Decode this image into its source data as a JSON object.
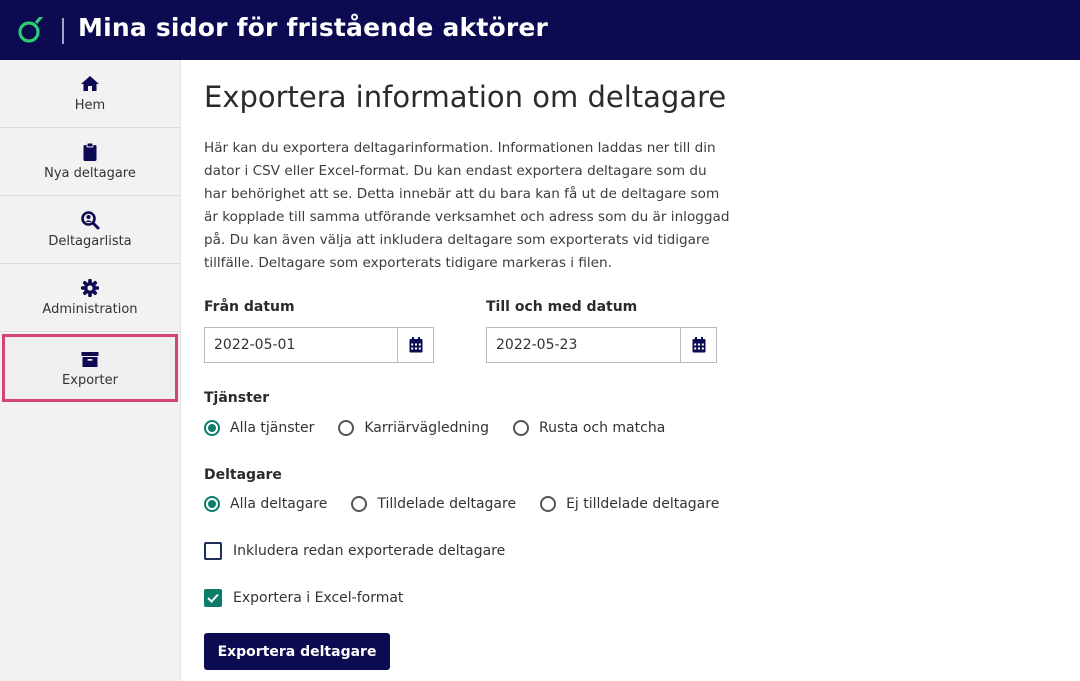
{
  "app": {
    "title": "Mina sidor för fristående aktörer",
    "brand_color": "#0c0b52",
    "accent_green": "#0a7c67",
    "active_border_color": "#d6427a"
  },
  "sidebar": {
    "items": [
      {
        "label": "Hem",
        "icon": "home-icon",
        "active": false
      },
      {
        "label": "Nya deltagare",
        "icon": "clipboard-icon",
        "active": false
      },
      {
        "label": "Deltagarlista",
        "icon": "search-user-icon",
        "active": false
      },
      {
        "label": "Administration",
        "icon": "gear-icon",
        "active": false
      },
      {
        "label": "Exporter",
        "icon": "archive-box-icon",
        "active": true
      }
    ]
  },
  "main": {
    "title": "Exportera information om deltagare",
    "intro": "Här kan du exportera deltagarinformation. Informationen laddas ner till din dator i CSV eller Excel-format. Du kan endast exportera deltagare som du har behörighet att se. Detta innebär att du bara kan få ut de deltagare som är kopplade till samma utförande verksamhet och adress som du är inloggad på. Du kan även välja att inkludera deltagare som exporterats vid tidigare tillfälle. Deltagare som exporterats tidigare markeras i filen.",
    "from_date": {
      "label": "Från datum",
      "value": "2022-05-01"
    },
    "to_date": {
      "label": "Till och med datum",
      "value": "2022-05-23"
    },
    "services": {
      "label": "Tjänster",
      "options": [
        "Alla tjänster",
        "Karriärvägledning",
        "Rusta och matcha"
      ],
      "selected": "Alla tjänster"
    },
    "participants": {
      "label": "Deltagare",
      "options": [
        "Alla deltagare",
        "Tilldelade deltagare",
        "Ej tilldelade deltagare"
      ],
      "selected": "Alla deltagare"
    },
    "include_exported": {
      "label": "Inkludera redan exporterade deltagare",
      "checked": false
    },
    "excel_format": {
      "label": "Exportera i Excel-format",
      "checked": true
    },
    "submit_label": "Exportera deltagare"
  }
}
